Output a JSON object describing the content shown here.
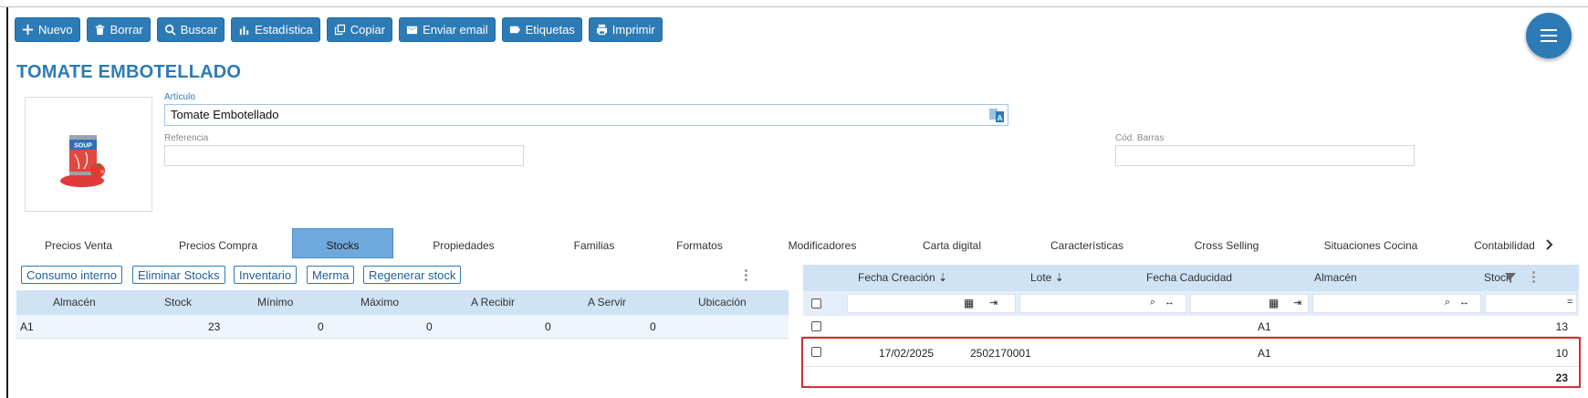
{
  "toolbar": {
    "buttons": [
      {
        "label": "Nuevo",
        "icon": "plus-icon"
      },
      {
        "label": "Borrar",
        "icon": "trash-icon"
      },
      {
        "label": "Buscar",
        "icon": "search-icon"
      },
      {
        "label": "Estadística",
        "icon": "bar-chart-icon"
      },
      {
        "label": "Copiar",
        "icon": "copy-icon"
      },
      {
        "label": "Enviar email",
        "icon": "mail-icon"
      },
      {
        "label": "Etiquetas",
        "icon": "tag-icon"
      },
      {
        "label": "Imprimir",
        "icon": "print-icon"
      }
    ]
  },
  "page_title": "TOMATE EMBOTELLADO",
  "image": {
    "can_label": "SOUP"
  },
  "form": {
    "articulo_label": "Artículo",
    "articulo_value": "Tomate Embotellado",
    "referencia_label": "Referencia",
    "referencia_value": "",
    "codbarras_label": "Cód. Barras",
    "codbarras_value": ""
  },
  "tabs": [
    "Precios Venta",
    "Precios Compra",
    "Stocks",
    "Propiedades",
    "Familias",
    "Formatos",
    "Modificadores",
    "Carta digital",
    "Características",
    "Cross Selling",
    "Situaciones Cocina",
    "Contabilidad"
  ],
  "active_tab": "Stocks",
  "stock_actions": [
    "Consumo interno",
    "Eliminar Stocks",
    "Inventario",
    "Merma",
    "Regenerar stock"
  ],
  "stock_table": {
    "headers": [
      "Almacén",
      "Stock",
      "Mínimo",
      "Máximo",
      "A Recibir",
      "A Servir",
      "Ubicación"
    ],
    "rows": [
      [
        "A1",
        "23",
        "0",
        "0",
        "0",
        "0",
        ""
      ]
    ]
  },
  "lots_grid": {
    "headers": [
      "Fecha Creación",
      "Lote",
      "Fecha Caducidad",
      "Almacén",
      "Stock"
    ],
    "group_row": {
      "almacen": "A1",
      "stock": "13"
    },
    "rows": [
      {
        "fecha_creacion": "17/02/2025",
        "lote": "2502170001",
        "fecha_caducidad": "",
        "almacen": "A1",
        "stock": "10"
      }
    ],
    "total": "23"
  },
  "colors": {
    "primary": "#2d7bb6",
    "header_bg": "#cfe3f5",
    "highlight_border": "#d32f2f"
  }
}
